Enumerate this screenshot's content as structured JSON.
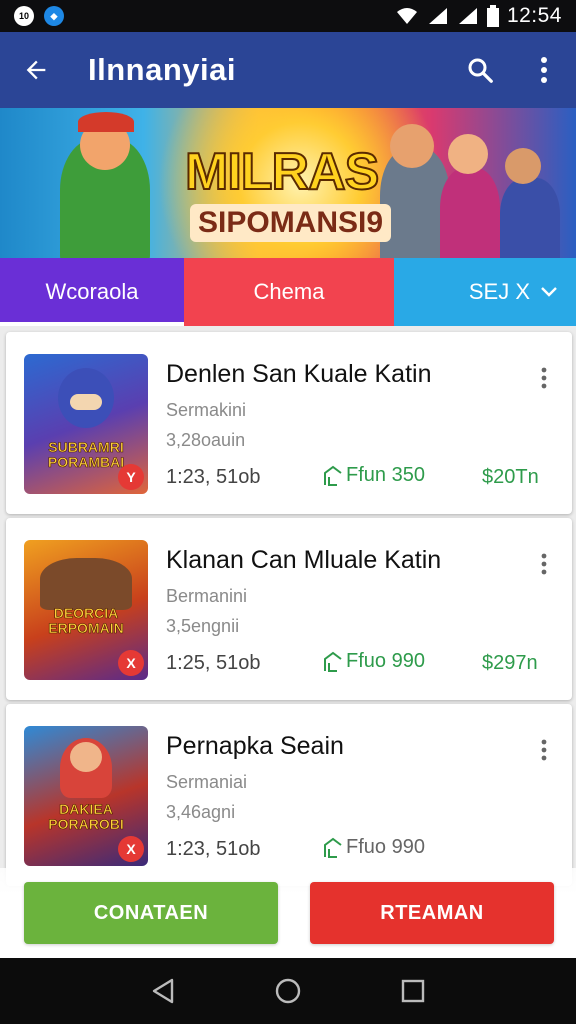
{
  "status_bar": {
    "time": "12:54",
    "left_icons": [
      "notification-icon",
      "app-icon"
    ],
    "battery": "battery-icon",
    "wifi": "wifi-icon",
    "signal": "signal-icon"
  },
  "app_bar": {
    "title": "Ilnnanyiai",
    "back_icon": "arrow-back-icon",
    "search_icon": "search-icon",
    "menu_icon": "more-vert-icon"
  },
  "banner": {
    "logo_line1": "MILRAS",
    "logo_line2": "SIPOMANSI9"
  },
  "tabs": [
    {
      "label": "Wcoraola",
      "color": "#6a2fd6"
    },
    {
      "label": "Chema",
      "color": "#f2434f"
    },
    {
      "label": "SEJ X",
      "color": "#29a9e6"
    }
  ],
  "items": [
    {
      "name": "Denlen San Kuale Katin",
      "sub1": "Sermakini",
      "sub2": "3,28oauin",
      "size": "1:23, 51ob",
      "downloads": "Ffun 350",
      "price": "$20Tn",
      "art_title": "SUBRAMRI PORAMBAI",
      "corner": "Y"
    },
    {
      "name": "Klanan Can Mluale Katin",
      "sub1": "Bermanini",
      "sub2": "3,5engnii",
      "size": "1:25, 51ob",
      "downloads": "Ffuo 990",
      "price": "$297n",
      "art_title": "DEORCIA ERPOMAIN",
      "corner": "X"
    },
    {
      "name": "Pernapka Seain",
      "sub1": "Sermaniai",
      "sub2": "3,46agni",
      "size": "1:23, 51ob",
      "downloads": "Ffuo 990",
      "price": "",
      "art_title": "DAKIEA PORAROBI",
      "corner": "X"
    }
  ],
  "buttons": {
    "left": "CONATAEN",
    "right": "RTEAMAN"
  }
}
